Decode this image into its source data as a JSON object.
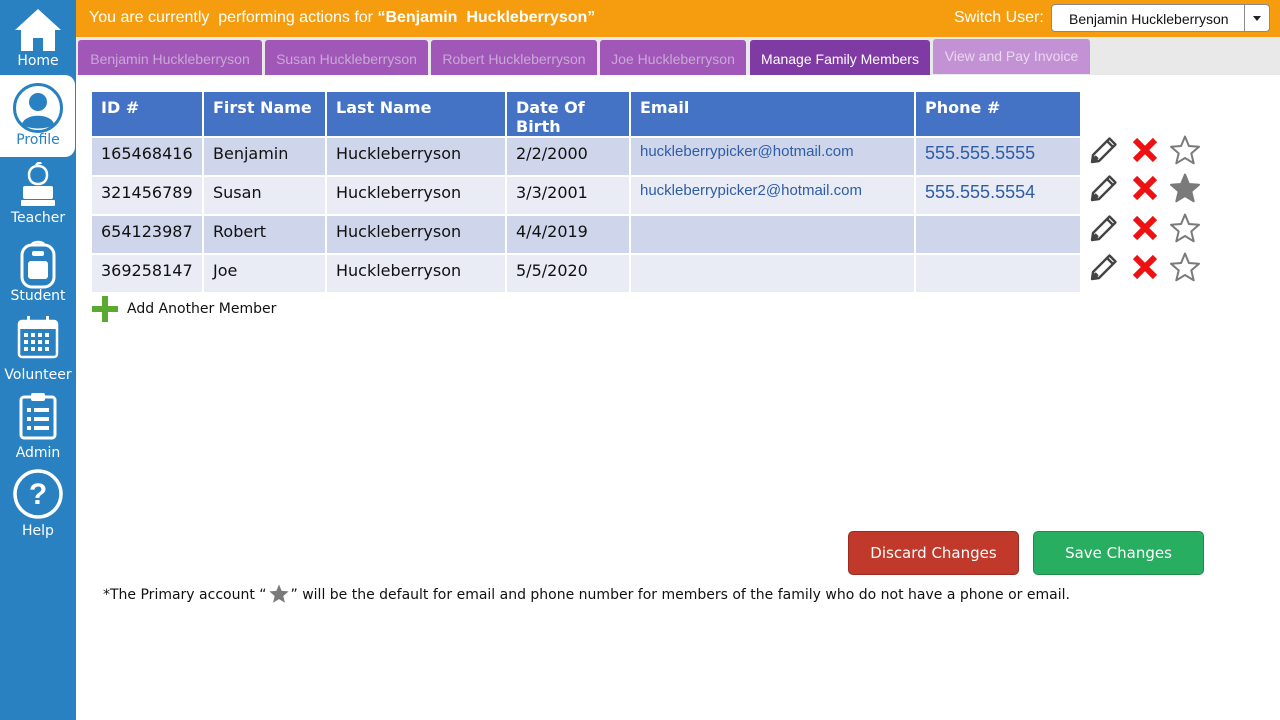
{
  "sidebar": {
    "items": [
      {
        "label": "Home",
        "icon": "home-icon"
      },
      {
        "label": "Profile",
        "icon": "user-icon"
      },
      {
        "label": "Teacher",
        "icon": "teacher-icon"
      },
      {
        "label": "Student",
        "icon": "backpack-icon"
      },
      {
        "label": "Volunteer",
        "icon": "calendar-icon"
      },
      {
        "label": "Admin",
        "icon": "clipboard-icon"
      },
      {
        "label": "Help",
        "icon": "help-icon"
      }
    ]
  },
  "header": {
    "prefix": "You are currently  performing actions for ",
    "user_name": "“Benjamin  Huckleberryson”",
    "switch_label": "Switch User:",
    "switch_value": "Benjamin Huckleberryson"
  },
  "tabs": [
    {
      "label": "Benjamin Huckleberryson"
    },
    {
      "label": "Susan Huckleberryson"
    },
    {
      "label": "Robert Huckleberryson"
    },
    {
      "label": "Joe Huckleberryson"
    },
    {
      "label": "Manage Family Members"
    },
    {
      "label": "View and Pay Invoice"
    }
  ],
  "table": {
    "headers": [
      "ID #",
      "First Name",
      "Last Name",
      "Date Of Birth",
      "Email",
      "Phone #"
    ],
    "rows": [
      {
        "id": "165468416",
        "first": "Benjamin",
        "last": "Huckleberryson",
        "dob": "2/2/2000",
        "email": "huckleberrypicker@hotmail.com",
        "phone": "555.555.5555",
        "primary": false
      },
      {
        "id": "321456789",
        "first": "Susan",
        "last": "Huckleberryson",
        "dob": "3/3/2001",
        "email": "huckleberrypicker2@hotmail.com",
        "phone": "555.555.5554",
        "primary": true
      },
      {
        "id": "654123987",
        "first": "Robert",
        "last": "Huckleberryson",
        "dob": "4/4/2019",
        "email": "",
        "phone": "",
        "primary": false
      },
      {
        "id": "369258147",
        "first": "Joe",
        "last": "Huckleberryson",
        "dob": "5/5/2020",
        "email": "",
        "phone": "",
        "primary": false
      }
    ]
  },
  "add_member_label": "Add Another Member",
  "buttons": {
    "discard": "Discard Changes",
    "save": "Save Changes"
  },
  "footnote": {
    "before": "*The Primary account “",
    "after": "” will be the default for email and phone  number  for members of the family who do not have a phone or email."
  },
  "colors": {
    "sidebar": "#2a81c2",
    "topbar": "#f59d0f",
    "tab": "#a057b8",
    "tab_active": "#7f3aa3",
    "table_header": "#4472c4",
    "discard": "#c0392b",
    "save": "#27ae60"
  }
}
